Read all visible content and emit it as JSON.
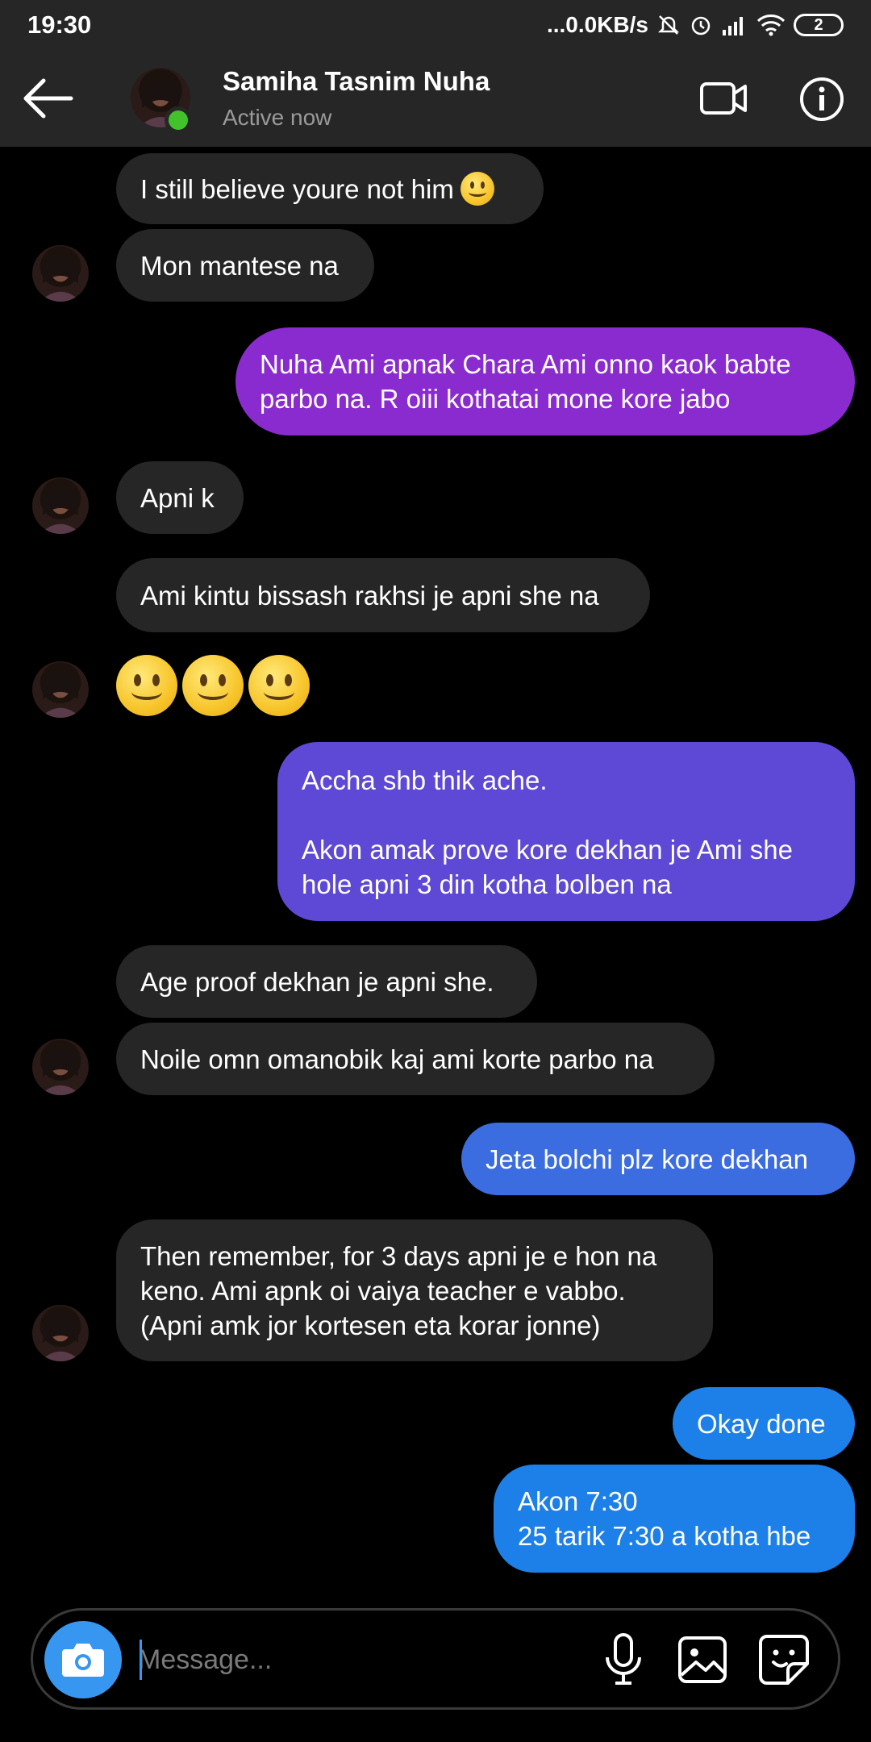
{
  "status_bar": {
    "time": "19:30",
    "network_speed": "...0.0KB/s",
    "battery_level": "2"
  },
  "header": {
    "name": "Samiha Tasnim Nuha",
    "status": "Active now",
    "icons": [
      "back-arrow-icon",
      "video-call-icon",
      "info-icon"
    ]
  },
  "messages": [
    {
      "side": "received",
      "text": "I still believe youre not him",
      "emoji": "slightly-smiling-face"
    },
    {
      "side": "received",
      "text": "Mon mantese na"
    },
    {
      "side": "sent",
      "text": "Nuha Ami apnak Chara Ami onno kaok babte parbo na. R oiii kothatai mone kore jabo"
    },
    {
      "side": "received",
      "text": "Apni k"
    },
    {
      "side": "received",
      "text": "Ami kintu bissash rakhsi je apni she na"
    },
    {
      "side": "received",
      "text": "",
      "emoji": "3x slightly-smiling-face"
    },
    {
      "side": "sent",
      "text": "Accha shb thik ache.\n\nAkon amak prove kore dekhan je Ami she hole apni 3 din kotha bolben na"
    },
    {
      "side": "received",
      "text": "Age proof dekhan je apni she."
    },
    {
      "side": "received",
      "text": "Noile omn omanobik kaj ami korte parbo na"
    },
    {
      "side": "sent",
      "text": "Jeta bolchi plz kore dekhan"
    },
    {
      "side": "received",
      "text": "Then remember, for 3 days apni je e hon na keno. Ami apnk oi vaiya teacher e vabbo. (Apni amk jor kortesen eta korar jonne)"
    },
    {
      "side": "sent",
      "text": "Okay done"
    },
    {
      "side": "sent",
      "text": "Akon 7:30\n25 tarik 7:30 a kotha hbe"
    }
  ],
  "composer": {
    "placeholder": "Message...",
    "icons": [
      "camera-icon",
      "microphone-icon",
      "gallery-icon",
      "sticker-icon"
    ]
  },
  "colors": {
    "received_bubble": "#262626",
    "sent_purple": "#8a2bd0",
    "sent_indigo": "#5e48d6",
    "sent_blue": "#3b6ce0",
    "sent_light_blue": "#1d7fe8",
    "accent": "#3797f0",
    "online": "#43c32b"
  }
}
